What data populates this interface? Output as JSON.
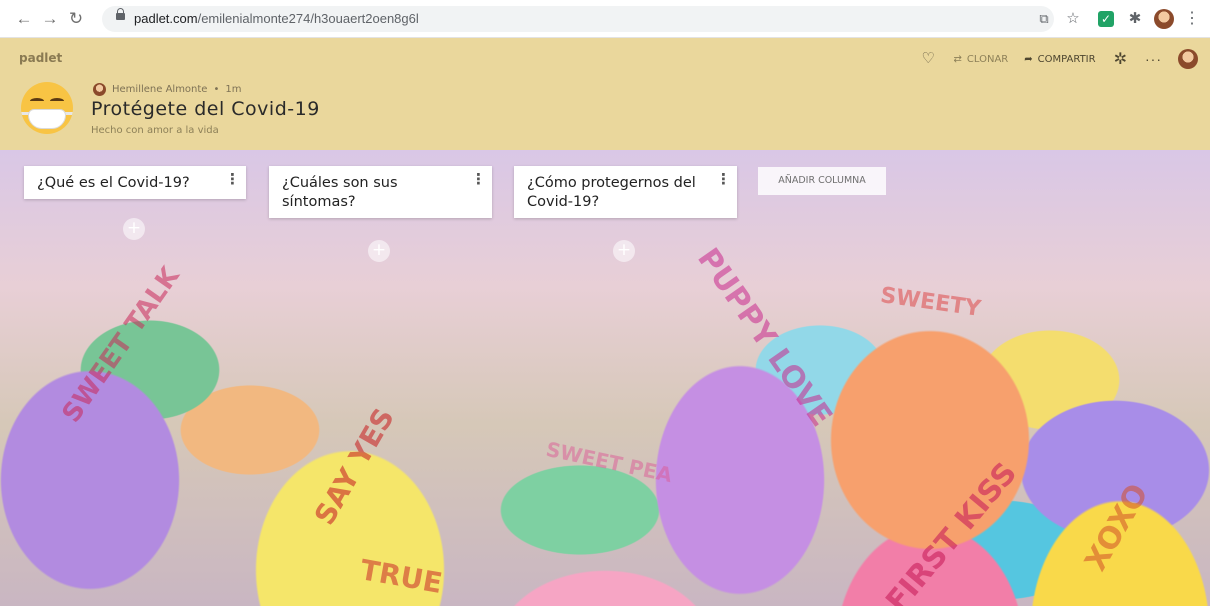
{
  "browser": {
    "url_host": "padlet.com",
    "url_path": "/emilenialmonte274/h3ouaert2oen8g6l",
    "back_icon": "arrow-left",
    "forward_icon": "arrow-right",
    "reload_icon": "reload"
  },
  "header": {
    "brand": "padlet",
    "author_name": "Hemillene Almonte",
    "separator": "•",
    "time_ago": "1m",
    "title": "Protégete del Covid-19",
    "subtitle": "Hecho con amor a la vida",
    "background_color": "#ead79c",
    "actions": {
      "clone_label": "CLONAR",
      "share_label": "COMPARTIR"
    }
  },
  "columns": [
    {
      "title": "¿Qué es el Covid-19?"
    },
    {
      "title": "¿Cuáles son sus síntomas?"
    },
    {
      "title": "¿Cómo protegernos del Covid-19?"
    }
  ],
  "add_column_label": "AÑADIR COLUMNA",
  "add_post_symbol": "+",
  "column_menu_symbol": "⋮",
  "candy_texts": [
    "SWEET TALK",
    "SAY YES",
    "PUPPY LOVE",
    "SWEET PEA",
    "FIRST KISS",
    "XOXO",
    "TRUE",
    "SWEETY"
  ]
}
